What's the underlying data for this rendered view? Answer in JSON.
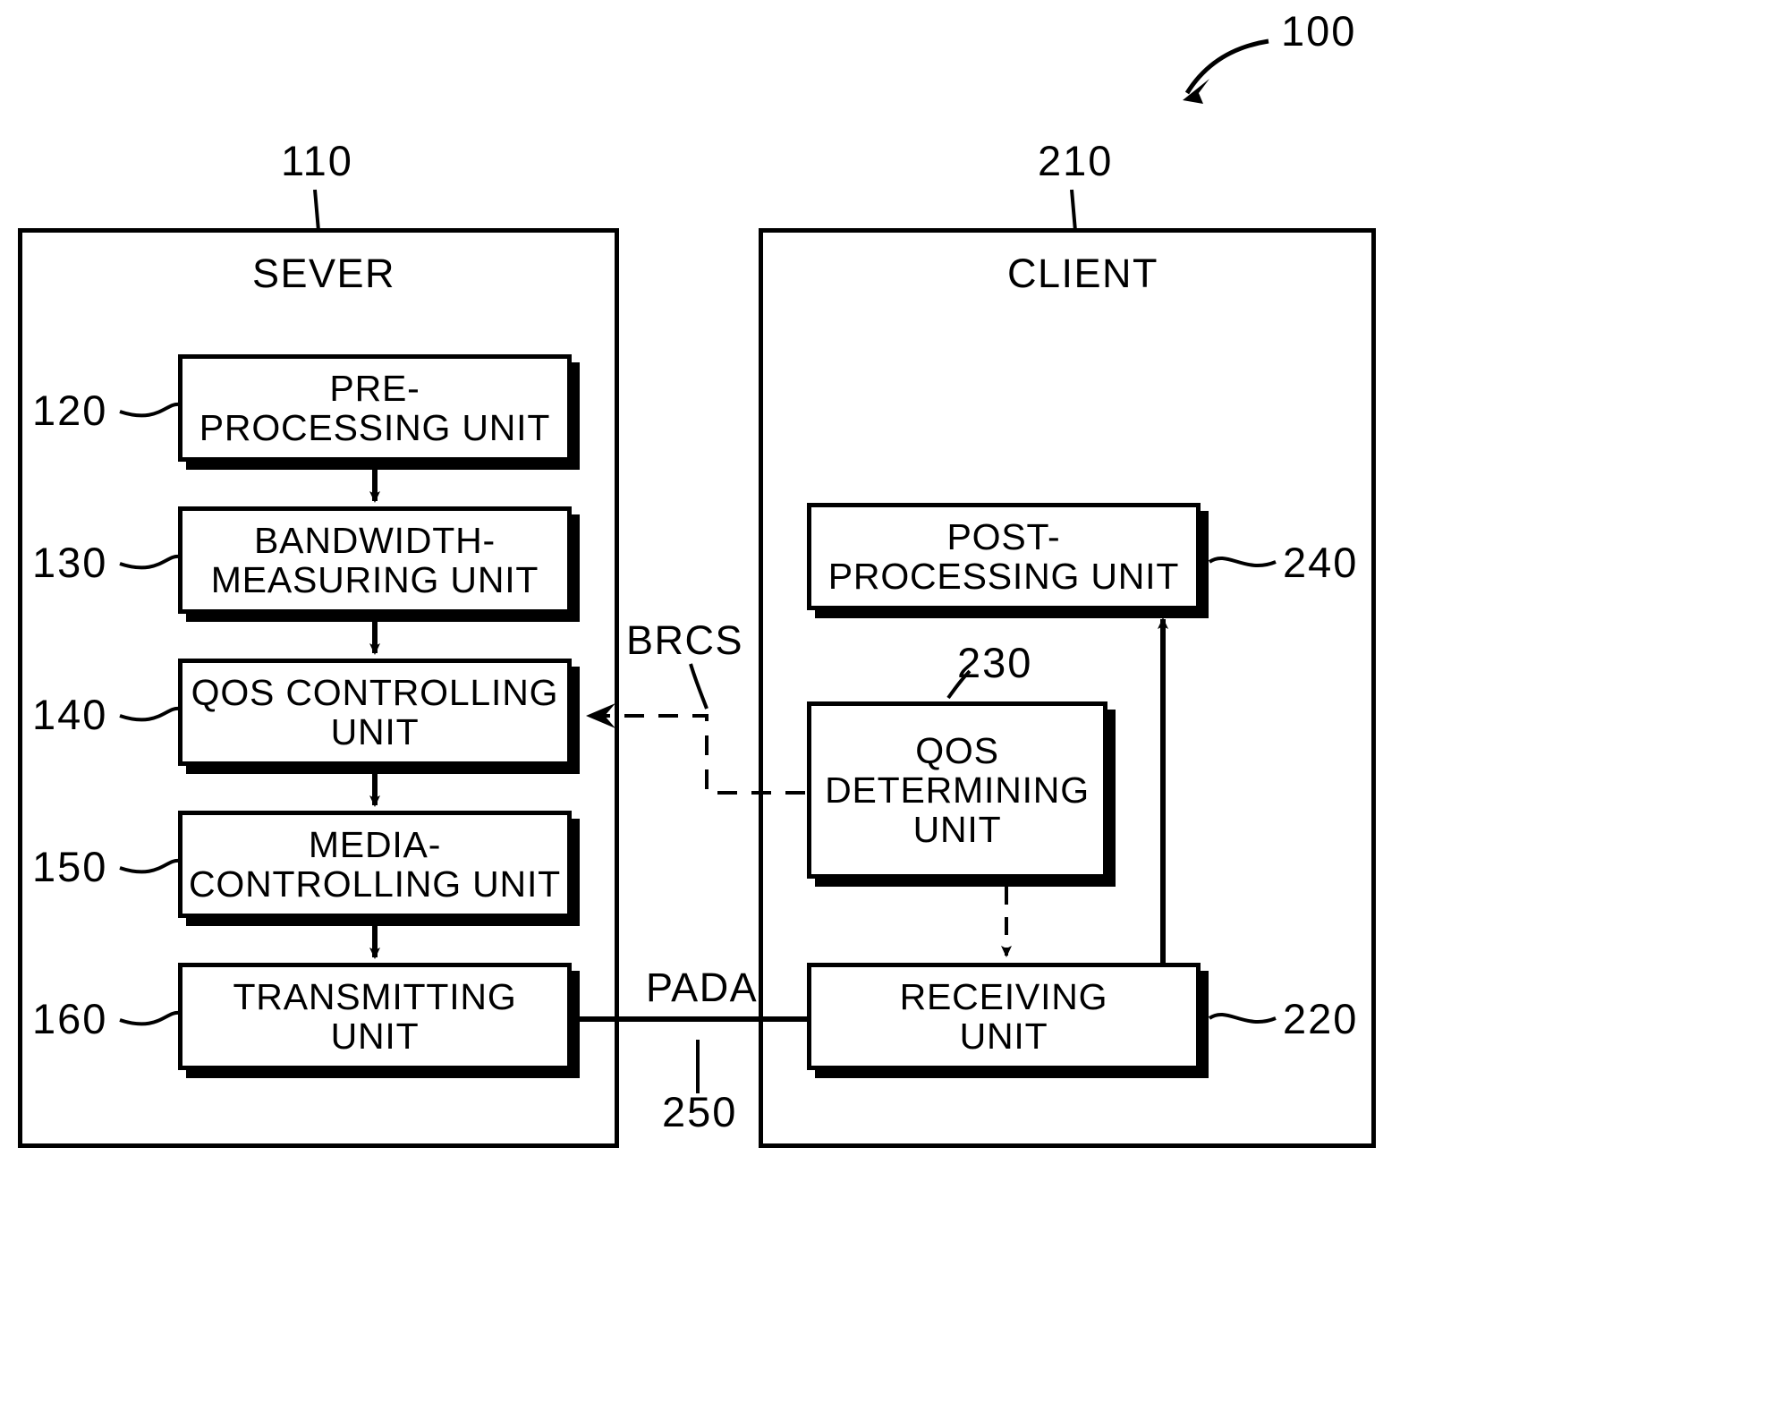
{
  "figure": {
    "reference_number": "100"
  },
  "server_panel": {
    "title": "SEVER",
    "reference_number": "110",
    "units": [
      {
        "ref": "120",
        "label": "PRE-\nPROCESSING UNIT"
      },
      {
        "ref": "130",
        "label": "BANDWIDTH-\nMEASURING UNIT"
      },
      {
        "ref": "140",
        "label": "QOS CONTROLLING\nUNIT"
      },
      {
        "ref": "150",
        "label": "MEDIA-\nCONTROLLING UNIT"
      },
      {
        "ref": "160",
        "label": "TRANSMITTING\nUNIT"
      }
    ]
  },
  "client_panel": {
    "title": "CLIENT",
    "reference_number": "210",
    "units": [
      {
        "ref": "240",
        "label": "POST-\nPROCESSING UNIT"
      },
      {
        "ref": "230",
        "label": "QOS\nDETERMINING\nUNIT"
      },
      {
        "ref": "220",
        "label": "RECEIVING\nUNIT"
      }
    ]
  },
  "signals": [
    {
      "name": "BRCS",
      "label": "BRCS",
      "ref": ""
    },
    {
      "name": "PADA",
      "label": "PADA",
      "ref": "250"
    }
  ],
  "colors": {
    "stroke": "#000000",
    "background": "#ffffff"
  }
}
